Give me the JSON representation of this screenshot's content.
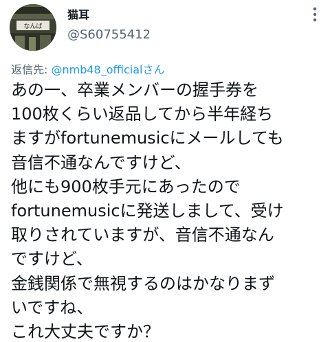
{
  "author": {
    "display_name": "猫耳",
    "handle": "@S60755412",
    "avatar_sign_text": "なんば",
    "avatar_icon": "avatar-photo"
  },
  "reply": {
    "prefix": "返信先: ",
    "mention": "@nmb48_official",
    "suffix": "さん"
  },
  "more_icon": "more-vertical-icon",
  "tweet": {
    "lines": [
      "あの一、卒業メンバーの握手券を",
      "100枚くらい返品してから半年経ち",
      "ますがfortunemusicにメールしても",
      "音信不通なんですけど、",
      "他にも900枚手元にあったので",
      "fortunemusicに発送しまして、受け",
      "取りされていますが、音信不通なん",
      "ですけど、",
      "金銭関係で無視するのはかなりまず",
      "いですね、",
      "これ大丈夫ですか？"
    ]
  },
  "colors": {
    "text": "#0f1419",
    "secondary": "#536471",
    "link": "#1d9bf0"
  }
}
